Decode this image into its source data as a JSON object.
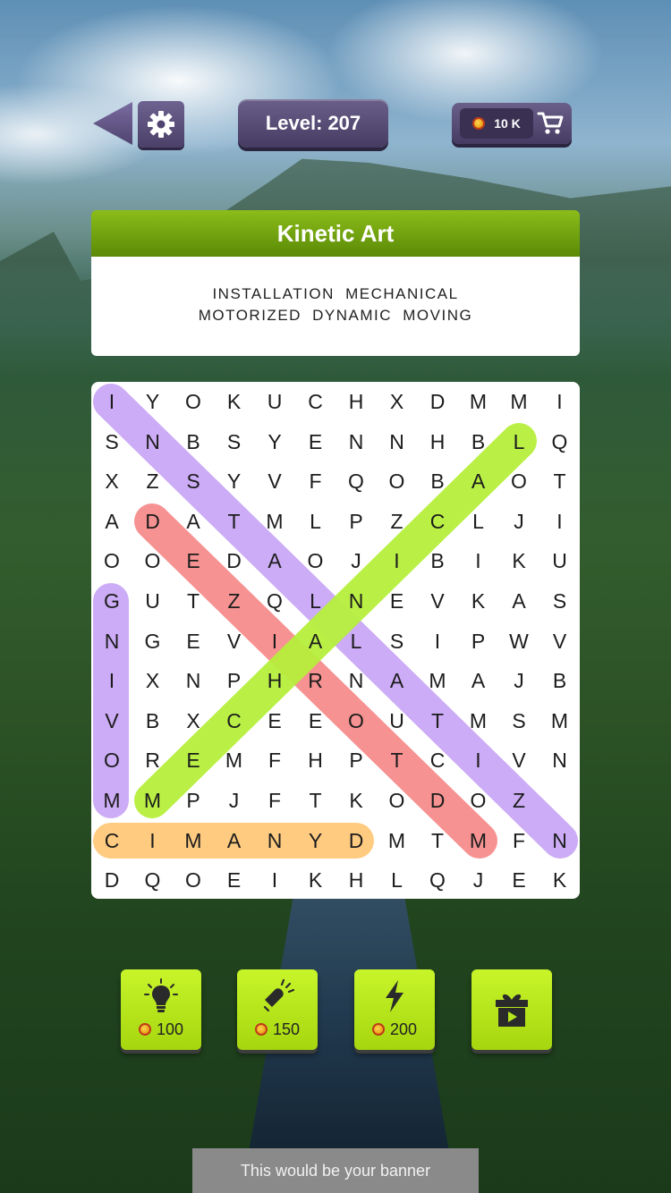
{
  "header": {
    "level_label": "Level:",
    "level_value": "207",
    "coins": "10 K"
  },
  "puzzle": {
    "title": "Kinetic Art",
    "words_line1": "INSTALLATION  MECHANICAL",
    "words_line2": "MOTORIZED  DYNAMIC  MOVING"
  },
  "grid": {
    "rows": [
      "IYOKUCHXDMMI",
      "SNBSYENNHBLQ",
      "XZSYVFQOBAOT",
      "ADATMLPZCLJI",
      "OOEDAOJIBIKU",
      "GUTZQLNEVKAS",
      "NGEVIALSIPWV",
      "IXNPHRNAMAJB",
      "VBXCEEOUTMSM",
      "OREMFHPTCIVN",
      "MMPJFTKODOZ",
      "CIMANYDMTMFN",
      "DQOEIKHLQJEK"
    ],
    "highlight_colors": {
      "installation": "#c9a8f5",
      "mechanical": "#b6ef3c",
      "motorized": "#f58c8c",
      "moving": "#c9a8f5",
      "dynamic": "#ffc87a"
    }
  },
  "powerups": [
    {
      "name": "hint",
      "icon": "lightbulb-icon",
      "cost": "100"
    },
    {
      "name": "magnet",
      "icon": "magnet-icon",
      "cost": "150"
    },
    {
      "name": "lightning",
      "icon": "lightning-icon",
      "cost": "200"
    },
    {
      "name": "gift",
      "icon": "gift-video-icon",
      "cost": ""
    }
  ],
  "banner": {
    "text": "This would be your banner"
  }
}
